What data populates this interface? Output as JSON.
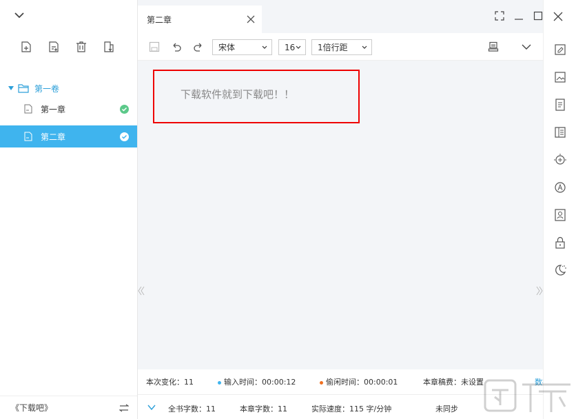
{
  "sidebar": {
    "volume": "第一卷",
    "chapters": [
      {
        "label": "第一章"
      },
      {
        "label": "第二章"
      }
    ],
    "book_name": "《下载吧》"
  },
  "tab": {
    "title": "第二章"
  },
  "toolbar": {
    "font": "宋体",
    "size": "16",
    "spacing": "1倍行距"
  },
  "editor": {
    "content": "下载软件就到下载吧！！"
  },
  "status": {
    "change_label": "本次变化：",
    "change_value": "11",
    "input_label": "输入时间：",
    "input_value": "00:00:12",
    "idle_label": "偷闲时间：",
    "idle_value": "00:00:01",
    "fee_label": "本章稿费：",
    "fee_value": "未设置",
    "data_settings": "数据设置",
    "total_label": "全书字数：",
    "total_value": "11",
    "chapter_label": "本章字数：",
    "chapter_value": "11",
    "speed_label": "实际速度：",
    "speed_value": "115 字/分钟",
    "sync": "未同步"
  },
  "colors": {
    "accent": "#3fb4ee",
    "accent_text": "#2c9fd9",
    "check_green": "#5cc98a",
    "input_dot": "#3fb4ee",
    "idle_dot": "#f07020",
    "highlight": "#e00000"
  },
  "icons": {
    "rail": [
      "note-icon",
      "image-icon",
      "document-icon",
      "outline-icon",
      "idea-icon",
      "character-icon",
      "contact-icon",
      "lock-icon",
      "night-mode-icon"
    ]
  }
}
